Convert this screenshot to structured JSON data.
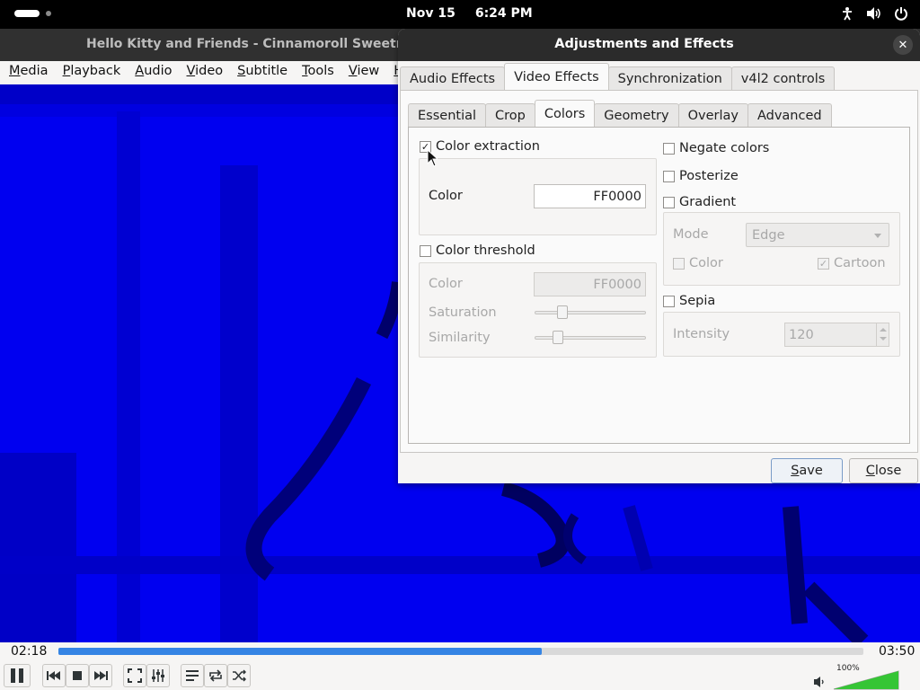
{
  "topbar": {
    "date": "Nov 15",
    "time": "6:24 PM",
    "tray_icons": [
      "accessibility-icon",
      "speaker-icon",
      "power-icon"
    ]
  },
  "vlc": {
    "window_title": "Hello Kitty and Friends - Cinnamoroll Sweetness! | H",
    "menu": [
      "Media",
      "Playback",
      "Audio",
      "Video",
      "Subtitle",
      "Tools",
      "View",
      "Help"
    ],
    "elapsed": "02:18",
    "total": "03:50",
    "progress_fraction": 0.6,
    "volume_label": "100%",
    "volume_fraction": 1.0,
    "accent": "#3584e4",
    "video_tint": "#0000f0"
  },
  "dialog": {
    "title": "Adjustments and Effects",
    "close_glyph": "✕",
    "outer_tabs": [
      "Audio Effects",
      "Video Effects",
      "Synchronization",
      "v4l2 controls"
    ],
    "outer_active": 1,
    "inner_tabs": [
      "Essential",
      "Crop",
      "Colors",
      "Geometry",
      "Overlay",
      "Advanced"
    ],
    "inner_active": 2,
    "color_extraction": {
      "label": "Color extraction",
      "checked": true,
      "color_label": "Color",
      "color_value": "FF0000"
    },
    "color_threshold": {
      "label": "Color threshold",
      "checked": false,
      "color_label": "Color",
      "color_value": "FF0000",
      "saturation_label": "Saturation",
      "saturation_level": 0.22,
      "similarity_label": "Similarity",
      "similarity_level": 0.18
    },
    "negate": {
      "label": "Negate colors",
      "checked": false
    },
    "posterize": {
      "label": "Posterize",
      "checked": false
    },
    "gradient": {
      "label": "Gradient",
      "checked": false,
      "mode_label": "Mode",
      "mode_value": "Edge",
      "color_label": "Color",
      "color_checked": false,
      "cartoon_label": "Cartoon",
      "cartoon_checked": true
    },
    "sepia": {
      "label": "Sepia",
      "checked": false,
      "intensity_label": "Intensity",
      "intensity_value": "120"
    },
    "save_label": "Save",
    "close_label": "Close"
  }
}
